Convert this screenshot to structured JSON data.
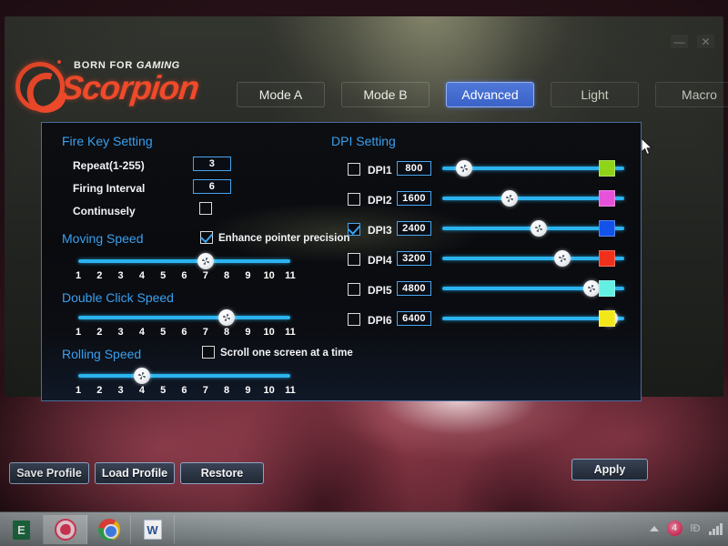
{
  "window": {
    "minimize_label": "—",
    "close_label": "✕"
  },
  "brand": {
    "tagline_prefix": "BORN FOR ",
    "tagline_accent": "GAMING",
    "name": "Scorpion",
    "logo_icon": "scorpion-logo-icon",
    "accent_color": "#ef4a2a"
  },
  "tabs": [
    {
      "label": "Mode A",
      "active": false
    },
    {
      "label": "Mode B",
      "active": false
    },
    {
      "label": "Advanced",
      "active": true
    },
    {
      "label": "Light",
      "active": false
    },
    {
      "label": "Macro",
      "active": false
    }
  ],
  "fire_key_setting": {
    "title": "Fire Key Setting",
    "repeat": {
      "label": "Repeat(1-255)",
      "value": "3"
    },
    "firing_interval": {
      "label": "Firing Interval",
      "value": "6"
    },
    "continuously": {
      "label": "Continusely",
      "checked": false
    }
  },
  "moving_speed": {
    "title": "Moving Speed",
    "value": 7,
    "min": 1,
    "max": 11,
    "ticks": [
      "1",
      "2",
      "3",
      "4",
      "5",
      "6",
      "7",
      "8",
      "9",
      "10",
      "11"
    ],
    "enhance_pointer_precision": {
      "label": "Enhance pointer precision",
      "checked": true
    }
  },
  "double_click_speed": {
    "title": "Double Click Speed",
    "value": 8,
    "min": 1,
    "max": 11,
    "ticks": [
      "1",
      "2",
      "3",
      "4",
      "5",
      "6",
      "7",
      "8",
      "9",
      "10",
      "11"
    ]
  },
  "rolling_speed": {
    "title": "Rolling Speed",
    "value": 4,
    "min": 1,
    "max": 11,
    "ticks": [
      "1",
      "2",
      "3",
      "4",
      "5",
      "6",
      "7",
      "8",
      "9",
      "10",
      "11"
    ],
    "scroll_one_screen": {
      "label": "Scroll one screen at a time",
      "checked": false
    }
  },
  "dpi_setting": {
    "title": "DPI Setting",
    "rows": [
      {
        "label": "DPI1",
        "value": "800",
        "checked": false,
        "slider_pct": 12,
        "color": "#8fd419"
      },
      {
        "label": "DPI2",
        "value": "1600",
        "checked": false,
        "slider_pct": 37,
        "color": "#e653d8"
      },
      {
        "label": "DPI3",
        "value": "2400",
        "checked": true,
        "slider_pct": 53,
        "color": "#1352e8"
      },
      {
        "label": "DPI4",
        "value": "3200",
        "checked": false,
        "slider_pct": 66,
        "color": "#f0301a"
      },
      {
        "label": "DPI5",
        "value": "4800",
        "checked": false,
        "slider_pct": 82,
        "color": "#63efe2"
      },
      {
        "label": "DPI6",
        "value": "6400",
        "checked": false,
        "slider_pct": 92,
        "color": "#f2e719"
      }
    ]
  },
  "actions": {
    "save_profile": "Save Profile",
    "load_profile": "Load Profile",
    "restore": "Restore",
    "apply": "Apply"
  },
  "taskbar": {
    "items": [
      {
        "icon": "excel-icon",
        "glyph": "E",
        "active": false
      },
      {
        "icon": "browser-icon",
        "glyph": "",
        "active": true
      },
      {
        "icon": "chrome-icon",
        "glyph": "",
        "active": false
      },
      {
        "icon": "word-icon",
        "glyph": "W",
        "active": false
      }
    ],
    "tray": {
      "show_hidden_icon": "chevron-up-icon",
      "notification_icon": "notification-badge-icon",
      "notification_glyph": "4",
      "network_icon": "network-signal-icon",
      "extra": "ſĐ"
    }
  }
}
